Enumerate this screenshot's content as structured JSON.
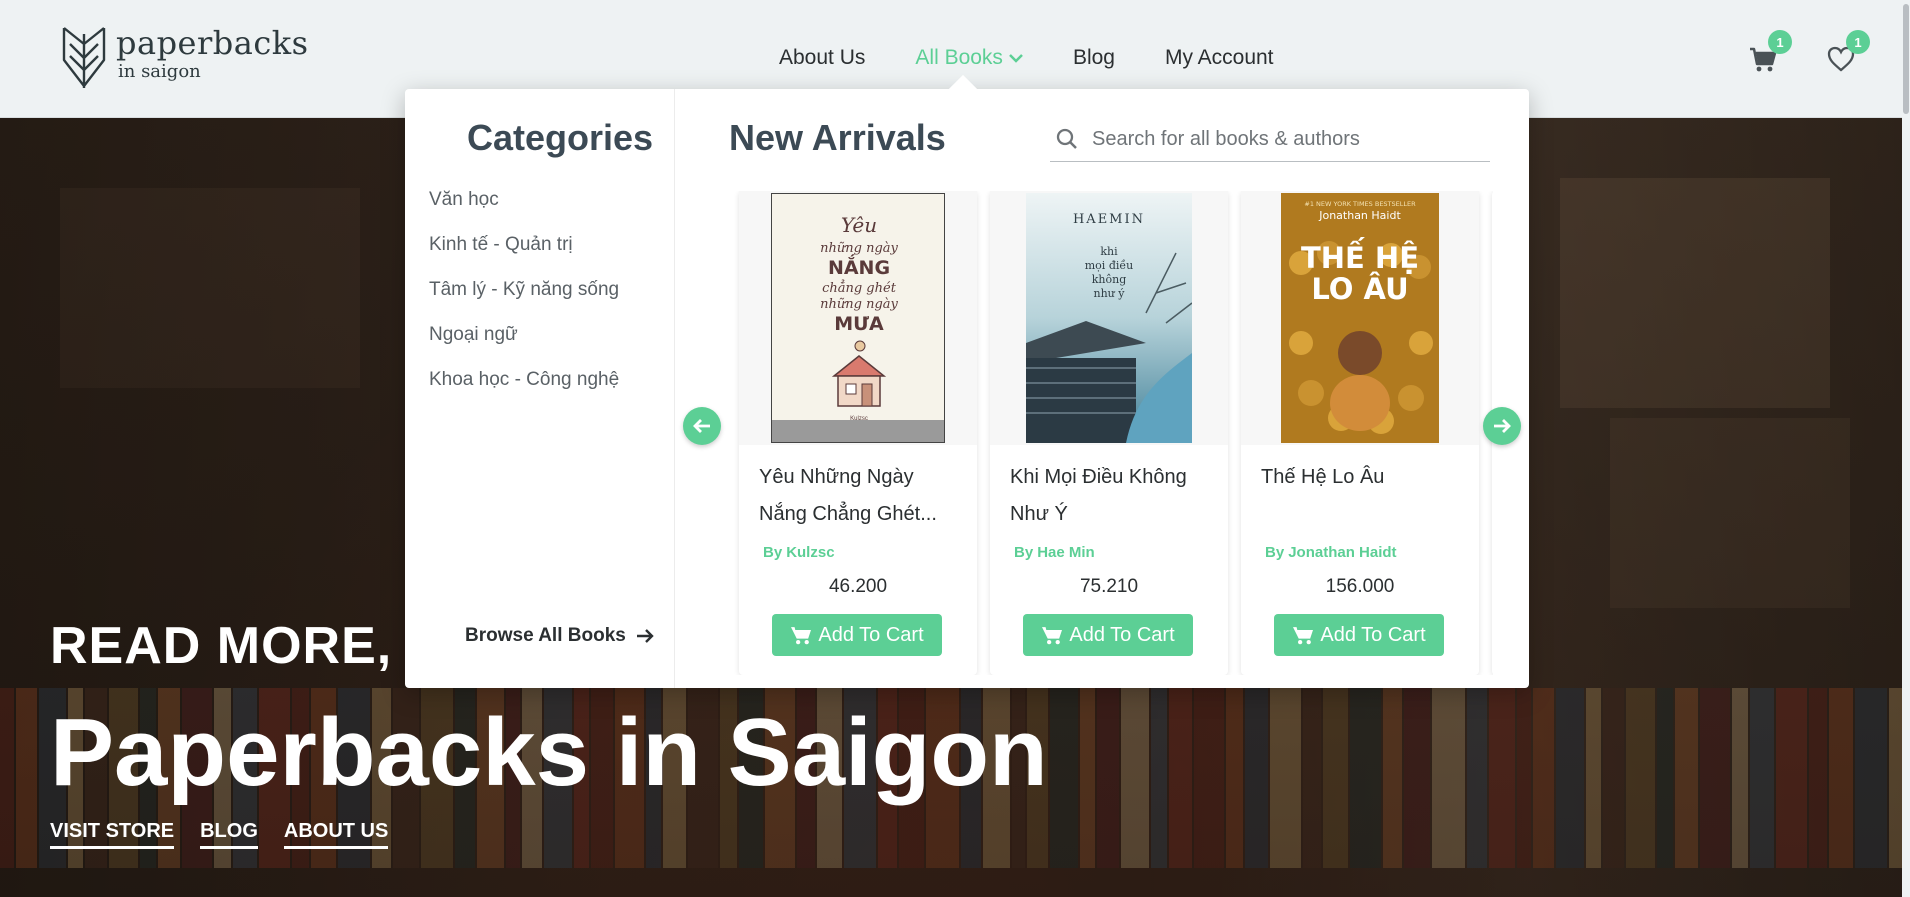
{
  "brand": {
    "name": "paperbacks",
    "sub": "in saigon"
  },
  "nav": {
    "items": [
      {
        "label": "About Us",
        "active": false
      },
      {
        "label": "All Books",
        "active": true
      },
      {
        "label": "Blog",
        "active": false
      },
      {
        "label": "My Account",
        "active": false
      }
    ]
  },
  "header": {
    "cart_count": "1",
    "wishlist_count": "1"
  },
  "mega_menu": {
    "categories_title": "Categories",
    "categories": [
      "Văn học",
      "Kinh tế - Quản trị",
      "Tâm lý - Kỹ năng sống",
      "Ngoại ngữ",
      "Khoa học - Công nghệ"
    ],
    "browse_label": "Browse All Books",
    "arrivals_title": "New Arrivals",
    "search_placeholder": "Search for all books & authors",
    "books": [
      {
        "title": "Yêu Những Ngày Nắng Chẳng Ghét...",
        "author_prefix": "By",
        "author": "Kulzsc",
        "price": "46.200",
        "cart_label": "Add To Cart",
        "cover_text": [
          "Yêu",
          "những ngày",
          "NẮNG",
          "chẳng ghét",
          "những ngày",
          "MƯA"
        ],
        "cover_small": "Kulzsc"
      },
      {
        "title": "Khi Mọi Điều Không Như Ý",
        "author_prefix": "By",
        "author": "Hae Min",
        "price": "75.210",
        "cart_label": "Add To Cart",
        "cover_text": [
          "HAEMIN",
          "khi",
          "mọi điều",
          "không",
          "như ý"
        ]
      },
      {
        "title": "Thế Hệ Lo Âu",
        "author_prefix": "By",
        "author": "Jonathan Haidt",
        "price": "156.000",
        "cart_label": "Add To Cart",
        "cover_text": [
          "#1 NEW YORK TIMES BESTSELLER",
          "Jonathan Haidt",
          "THẾ HỆ",
          "LO ÂU"
        ]
      }
    ]
  },
  "hero": {
    "tagline": "READ MORE, C",
    "title": "Paperbacks in Saigon",
    "links": [
      "VISIT STORE",
      "BLOG",
      "ABOUT US"
    ]
  },
  "colors": {
    "accent": "#5ccf95",
    "heading": "#3c4a55",
    "header_bg": "#eef2f3"
  }
}
